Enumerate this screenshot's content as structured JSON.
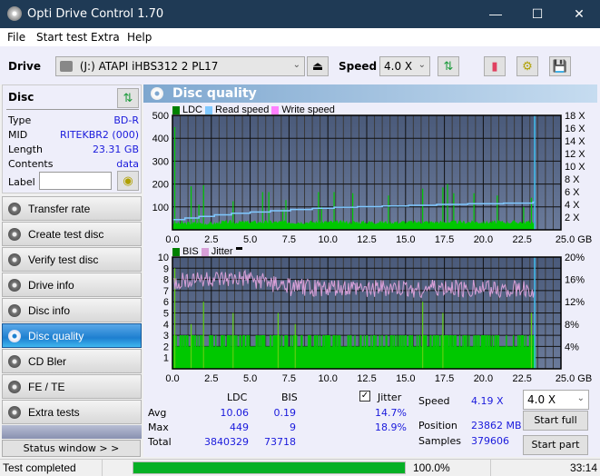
{
  "window": {
    "title": "Opti Drive Control 1.70",
    "minimize": "—",
    "maximize": "☐",
    "close": "✕"
  },
  "menu": [
    "File",
    "Start test",
    "Extra",
    "Help"
  ],
  "toolbar": {
    "drive_label": "Drive",
    "drive_value": "(J:)  ATAPI iHBS312  2 PL17",
    "speed_label": "Speed",
    "speed_value": "4.0 X",
    "icons": [
      "eject-icon",
      "refresh-icon",
      "erase-icon",
      "settings-icon",
      "save-icon"
    ]
  },
  "disc": {
    "header": "Disc",
    "rows": [
      {
        "key": "Type",
        "value": "BD-R"
      },
      {
        "key": "MID",
        "value": "RITEKBR2 (000)"
      },
      {
        "key": "Length",
        "value": "23.31 GB"
      },
      {
        "key": "Contents",
        "value": "data"
      }
    ],
    "label_key": "Label",
    "label_value": ""
  },
  "nav": [
    {
      "label": "Transfer rate",
      "active": false
    },
    {
      "label": "Create test disc",
      "active": false
    },
    {
      "label": "Verify test disc",
      "active": false
    },
    {
      "label": "Drive info",
      "active": false
    },
    {
      "label": "Disc info",
      "active": false
    },
    {
      "label": "Disc quality",
      "active": true
    },
    {
      "label": "CD Bler",
      "active": false
    },
    {
      "label": "FE / TE",
      "active": false
    },
    {
      "label": "Extra tests",
      "active": false
    }
  ],
  "status_window_button": "Status window > >",
  "panel": {
    "title": "Disc quality"
  },
  "colors": {
    "ldc": "#00c800",
    "read_speed": "#80c8ff",
    "write_speed": "#ff80ff",
    "bis": "#00c800",
    "jitter": "#d8a0d8",
    "plot_bg_top": "#4a5a7a",
    "plot_bg_bottom": "#6a7a9a",
    "progress": "#06b025"
  },
  "chart_data": [
    {
      "type": "bar",
      "title": "LDC / Read speed",
      "legend": [
        "LDC",
        "Read speed",
        "Write speed"
      ],
      "xlabel": "GB",
      "x_ticks": [
        "0.0",
        "2.5",
        "5.0",
        "7.5",
        "10.0",
        "12.5",
        "15.0",
        "17.5",
        "20.0",
        "22.5",
        "25.0 GB"
      ],
      "xlim": [
        0,
        25
      ],
      "ylim_left": [
        0,
        500
      ],
      "y_ticks_left": [
        "500",
        "400",
        "300",
        "200",
        "100"
      ],
      "ylim_right": [
        0,
        18
      ],
      "y_ticks_right": [
        "18 X",
        "16 X",
        "14 X",
        "12 X",
        "10 X",
        "8 X",
        "6 X",
        "4 X",
        "2 X"
      ],
      "ldc_spikes": [
        [
          0.15,
          449
        ],
        [
          0.6,
          40
        ],
        [
          1.2,
          190
        ],
        [
          1.5,
          50
        ],
        [
          1.7,
          110
        ],
        [
          2.0,
          195
        ],
        [
          3.9,
          125
        ],
        [
          5.8,
          165
        ],
        [
          6.2,
          165
        ],
        [
          7.1,
          90
        ],
        [
          7.3,
          130
        ],
        [
          9.4,
          165
        ],
        [
          9.6,
          100
        ],
        [
          10.4,
          165
        ],
        [
          11.6,
          160
        ],
        [
          13.9,
          150
        ],
        [
          16.1,
          180
        ],
        [
          17.4,
          185
        ],
        [
          17.7,
          200
        ],
        [
          18.1,
          160
        ],
        [
          19.4,
          160
        ],
        [
          20.9,
          150
        ],
        [
          22.6,
          100
        ],
        [
          23.1,
          140
        ]
      ],
      "ldc_baseline": 20,
      "read_speed_x": [
        0,
        0.8,
        1.7,
        2.7,
        3.8,
        5.0,
        6.3,
        7.6,
        9.0,
        10.4,
        11.9,
        13.5,
        15.2,
        17.0,
        19.0,
        21.3,
        23.2
      ],
      "read_speed_y": [
        1.6,
        1.85,
        2.1,
        2.35,
        2.6,
        2.8,
        3.0,
        3.2,
        3.4,
        3.55,
        3.65,
        3.75,
        3.85,
        4.0,
        4.1,
        4.2,
        4.35
      ],
      "end_marker_gb": 23.31
    },
    {
      "type": "bar",
      "title": "BIS / Jitter",
      "legend": [
        "BIS",
        "Jitter"
      ],
      "xlabel": "GB",
      "x_ticks": [
        "0.0",
        "2.5",
        "5.0",
        "7.5",
        "10.0",
        "12.5",
        "15.0",
        "17.5",
        "20.0",
        "22.5",
        "25.0 GB"
      ],
      "xlim": [
        0,
        25
      ],
      "ylim_left": [
        0,
        10
      ],
      "y_ticks_left": [
        "10",
        "9",
        "8",
        "7",
        "6",
        "5",
        "4",
        "3",
        "2",
        "1"
      ],
      "ylim_right": [
        0,
        20
      ],
      "y_ticks_right": [
        "20%",
        "16%",
        "12%",
        "8%",
        "4%"
      ],
      "bis_spikes": [
        [
          0.15,
          9
        ],
        [
          1.2,
          4
        ],
        [
          2.0,
          6
        ],
        [
          3.9,
          5
        ],
        [
          6.8,
          5
        ],
        [
          7.9,
          4
        ],
        [
          16.1,
          6
        ],
        [
          17.4,
          5
        ],
        [
          23.1,
          5
        ]
      ],
      "bis_baseline": 2,
      "bis_plateau": 3,
      "jitter_avg_pct": 14.7,
      "jitter_max_pct": 18.9,
      "jitter_trend_x": [
        0,
        1,
        2,
        3,
        4,
        5,
        6,
        7,
        8,
        10,
        12,
        14,
        16,
        18,
        20,
        22,
        23.3
      ],
      "jitter_trend_y": [
        15.0,
        16.0,
        16.2,
        15.8,
        15.9,
        16.0,
        15.5,
        14.8,
        14.5,
        14.4,
        14.3,
        14.3,
        14.3,
        14.4,
        14.3,
        14.3,
        14.2
      ],
      "end_marker_gb": 23.31
    }
  ],
  "stats": {
    "col_ldc": "LDC",
    "col_bis": "BIS",
    "jitter_label": "Jitter",
    "jitter_checked": true,
    "rows": [
      {
        "label": "Avg",
        "ldc": "10.06",
        "bis": "0.19",
        "jitter": "14.7%"
      },
      {
        "label": "Max",
        "ldc": "449",
        "bis": "9",
        "jitter": "18.9%"
      },
      {
        "label": "Total",
        "ldc": "3840329",
        "bis": "73718",
        "jitter": ""
      }
    ],
    "speed_label": "Speed",
    "speed_value": "4.19 X",
    "position_label": "Position",
    "position_value": "23862 MB",
    "samples_label": "Samples",
    "samples_value": "379606",
    "speed_select": "4.0 X",
    "start_full": "Start full",
    "start_part": "Start part"
  },
  "statusbar": {
    "text": "Test completed",
    "progress_pct": 100,
    "progress_text": "100.0%",
    "time": "33:14"
  }
}
